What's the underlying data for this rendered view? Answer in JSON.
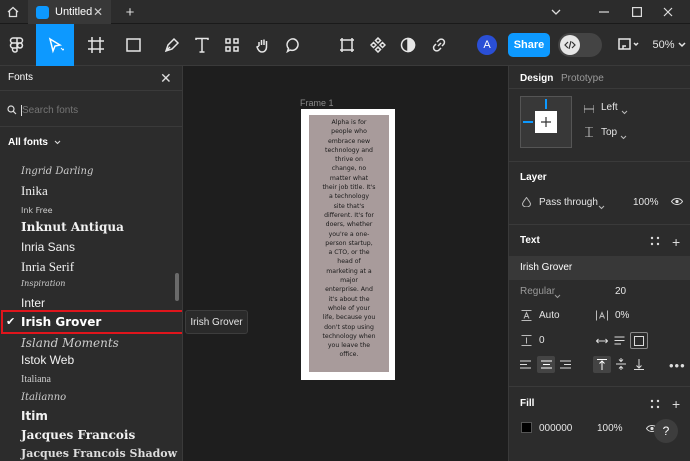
{
  "titlebar": {
    "tab_title": "Untitled",
    "new_tab": "+"
  },
  "toolbar": {
    "avatar_initial": "A",
    "share_label": "Share",
    "zoom": "50%"
  },
  "fonts_panel": {
    "title": "Fonts",
    "search_placeholder": "Search fonts",
    "filter_label": "All fonts",
    "items": [
      {
        "label": "Ingrid Darling"
      },
      {
        "label": "Inika"
      },
      {
        "label": "Ink Free"
      },
      {
        "label": "Inknut Antiqua"
      },
      {
        "label": "Inria Sans"
      },
      {
        "label": "Inria Serif"
      },
      {
        "label": "Inspiration"
      },
      {
        "label": "Inter"
      },
      {
        "label": "Irish Grover"
      },
      {
        "label": "Island Moments"
      },
      {
        "label": "Istok Web"
      },
      {
        "label": "Italiana"
      },
      {
        "label": "Italianno"
      },
      {
        "label": "Itim"
      },
      {
        "label": "Jacques Francois"
      },
      {
        "label": "Jacques Francois Shadow"
      }
    ],
    "selected": "Irish Grover",
    "tooltip": "Irish Grover"
  },
  "canvas": {
    "frame_label": "Frame 1",
    "text_lines": [
      "Alpha is for",
      "people who",
      "embrace new",
      "technology and",
      "thrive on",
      "change, no",
      "matter what",
      "their job title. It's",
      "a technology",
      "site that's",
      "different. It's for",
      "doers, whether",
      "you're a one-",
      "person startup,",
      "a CTO, or the",
      "head of",
      "marketing at a",
      "major",
      "enterprise. And",
      "it's about the",
      "whole of your",
      "life, because you",
      "don't stop using",
      "technology when",
      "you leave the",
      "office."
    ]
  },
  "design_panel": {
    "tabs": [
      "Design",
      "Prototype"
    ],
    "align_h": "Left",
    "align_v": "Top",
    "layer_title": "Layer",
    "blend_mode": "Pass through",
    "layer_opacity": "100%",
    "text_title": "Text",
    "font_family": "Irish Grover",
    "font_weight": "Regular",
    "font_size": "20",
    "line_height": "Auto",
    "letter_spacing": "0%",
    "paragraph_spacing": "0",
    "fill_title": "Fill",
    "fill_hex": "000000",
    "fill_opacity": "100%",
    "help": "?",
    "colors": {
      "accent": "#0d99ff",
      "frame_fill": "#a89b9b",
      "selection": "#e0151c"
    }
  }
}
